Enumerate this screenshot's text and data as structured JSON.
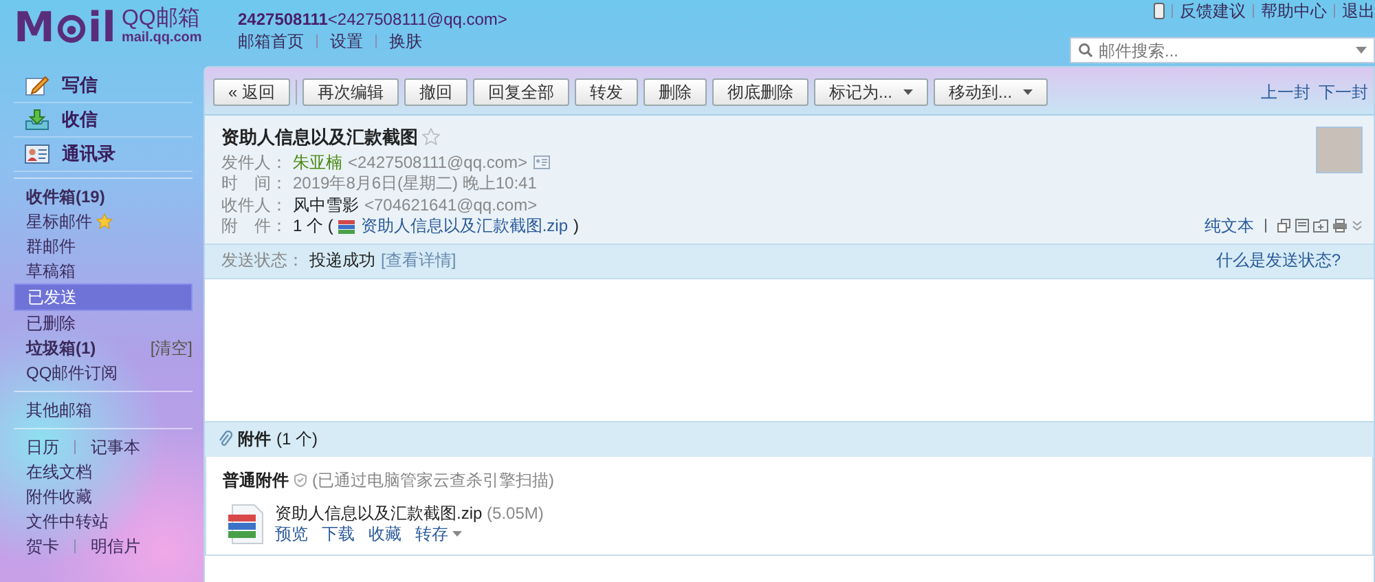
{
  "header": {
    "logo": {
      "left": "M",
      "right": "il",
      "name": "QQ邮箱",
      "domain": "mail.qq.com"
    },
    "account_id": "2427508111",
    "account_email": "<2427508111@qq.com>",
    "links": [
      "邮箱首页",
      "设置",
      "换肤"
    ],
    "top_links": [
      "反馈建议",
      "帮助中心",
      "退出"
    ],
    "search": {
      "placeholder": "邮件搜索..."
    }
  },
  "sidebar": {
    "actions": [
      {
        "label": "写信",
        "kind": "compose"
      },
      {
        "label": "收信",
        "kind": "receive"
      },
      {
        "label": "通讯录",
        "kind": "contacts"
      }
    ],
    "groups": [
      [
        {
          "labels": [
            "收件箱(19)"
          ],
          "bold": true,
          "selected": false
        },
        {
          "labels": [
            "星标邮件"
          ],
          "bold": false,
          "selected": false,
          "kind": "star"
        },
        {
          "labels": [
            "群邮件"
          ],
          "bold": false,
          "selected": false
        },
        {
          "labels": [
            "草稿箱"
          ],
          "bold": false,
          "selected": false
        },
        {
          "labels": [
            "已发送"
          ],
          "bold": false,
          "selected": true
        },
        {
          "labels": [
            "已删除"
          ],
          "bold": false,
          "selected": false
        },
        {
          "labels": [
            "垃圾箱(1)"
          ],
          "bold": true,
          "selected": false,
          "extra": "[清空]"
        },
        {
          "labels": [
            "QQ邮件订阅"
          ],
          "bold": false,
          "selected": false
        }
      ],
      [
        {
          "labels": [
            "其他邮箱"
          ],
          "bold": false,
          "selected": false
        }
      ],
      [
        {
          "labels": [
            "日历",
            "记事本"
          ],
          "bold": false,
          "selected": false
        },
        {
          "labels": [
            "在线文档"
          ],
          "bold": false,
          "selected": false
        },
        {
          "labels": [
            "附件收藏"
          ],
          "bold": false,
          "selected": false
        },
        {
          "labels": [
            "文件中转站"
          ],
          "bold": false,
          "selected": false
        },
        {
          "labels": [
            "贺卡",
            "明信片"
          ],
          "bold": false,
          "selected": false
        }
      ]
    ]
  },
  "toolbar": {
    "back": "« 返回",
    "buttons": [
      {
        "label": "再次编辑",
        "kind": "plain"
      },
      {
        "label": "撤回",
        "kind": "plain"
      },
      {
        "label": "回复全部",
        "kind": "plain"
      },
      {
        "label": "转发",
        "kind": "plain"
      },
      {
        "label": "删除",
        "kind": "plain"
      },
      {
        "label": "彻底删除",
        "kind": "plain"
      },
      {
        "label": "标记为...",
        "kind": "dropdown"
      },
      {
        "label": "移动到...",
        "kind": "dropdown"
      }
    ],
    "nav": [
      "上一封",
      "下一封"
    ]
  },
  "mail": {
    "subject": "资助人信息以及汇款截图",
    "starred": false,
    "from": {
      "label": "发件人：",
      "name": "朱亚楠",
      "email": "<2427508111@qq.com>"
    },
    "time": {
      "label": "时　间：",
      "value": "2019年8月6日(星期二) 晚上10:41"
    },
    "to": {
      "label": "收件人：",
      "name": "风中雪影",
      "email": "<704621641@qq.com>"
    },
    "attach": {
      "label": "附　件：",
      "count": "1 个 (",
      "file": "资助人信息以及汇款截图.zip",
      "close": ")"
    },
    "view_link": "纯文本",
    "status": {
      "label": "发送状态：",
      "value": "投递成功",
      "link": "[查看详情]",
      "help": "什么是发送状态?"
    }
  },
  "attachments": {
    "title": "附件",
    "count": "(1 个)",
    "group": "普通附件",
    "scan_note": "(已通过电脑管家云查杀引擎扫描)",
    "file": {
      "name": "资助人信息以及汇款截图.zip",
      "size": "(5.05M)",
      "actions": [
        {
          "label": "预览",
          "kind": "link"
        },
        {
          "label": "下载",
          "kind": "link"
        },
        {
          "label": "收藏",
          "kind": "link"
        },
        {
          "label": "转存",
          "kind": "dropdown"
        }
      ]
    }
  }
}
